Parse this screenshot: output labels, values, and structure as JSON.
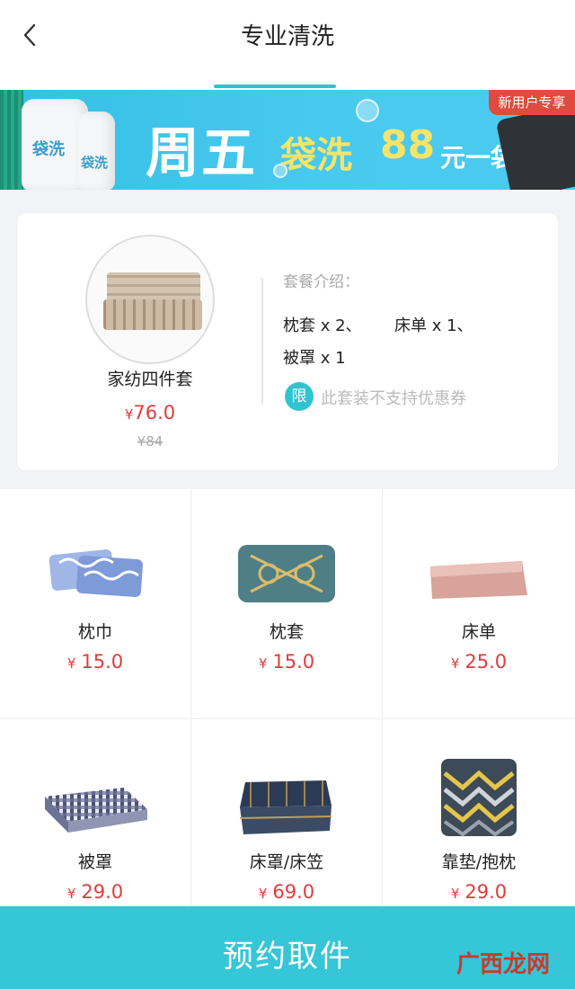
{
  "header": {
    "title": "专业清洗"
  },
  "banner": {
    "badge": "新用户专享",
    "day": "周五",
    "brand": "袋洗",
    "price": "88",
    "unit": "元一袋",
    "bag_text": "袋洗",
    "slides_active": 1
  },
  "package": {
    "name": "家纺四件套",
    "currency": "¥",
    "price": "76.0",
    "old_price": "¥84",
    "intro_title": "套餐介绍：",
    "items": [
      "枕套 x 2、",
      "床单 x 1、",
      "被罩 x 1"
    ],
    "limit_badge": "限",
    "limit_text": "此套装不支持优惠券"
  },
  "products": [
    {
      "name": "枕巾",
      "currency": "¥",
      "price": "15.0",
      "icon": "pillow-towel-image"
    },
    {
      "name": "枕套",
      "currency": "¥",
      "price": "15.0",
      "icon": "pillowcase-image"
    },
    {
      "name": "床单",
      "currency": "¥",
      "price": "25.0",
      "icon": "bedsheet-image"
    },
    {
      "name": "被罩",
      "currency": "¥",
      "price": "29.0",
      "icon": "duvet-cover-image"
    },
    {
      "name": "床罩/床笠",
      "currency": "¥",
      "price": "69.0",
      "icon": "bedspread-image"
    },
    {
      "name": "靠垫/抱枕",
      "currency": "¥",
      "price": "29.0",
      "icon": "cushion-image"
    }
  ],
  "cta": {
    "label": "预约取件"
  },
  "watermark": "广西龙网",
  "colors": {
    "accent": "#35c6d7",
    "price": "#e23b3b",
    "badge": "#e04b3f"
  }
}
